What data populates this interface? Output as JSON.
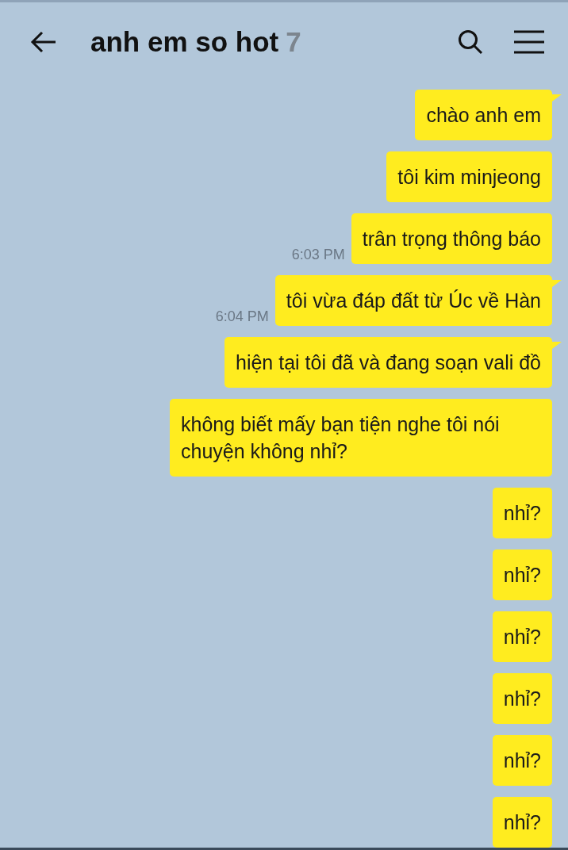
{
  "header": {
    "title": "anh em so hot",
    "member_count": "7"
  },
  "messages": [
    {
      "text": "chào anh em",
      "tail": true
    },
    {
      "text": "tôi kim minjeong",
      "tail": false
    },
    {
      "text": "trân trọng thông báo",
      "tail": false,
      "time": "6:03 PM"
    },
    {
      "text": "tôi vừa đáp đất từ Úc về Hàn",
      "tail": true,
      "time": "6:04 PM"
    },
    {
      "text": "hiện tại tôi đã và đang soạn vali đồ",
      "tail": true
    },
    {
      "text": "không biết mấy bạn tiện nghe tôi nói chuyện không nhỉ?",
      "tail": false
    },
    {
      "text": "nhỉ?",
      "tail": false
    },
    {
      "text": "nhỉ?",
      "tail": false
    },
    {
      "text": "nhỉ?",
      "tail": false
    },
    {
      "text": "nhỉ?",
      "tail": false
    },
    {
      "text": "nhỉ?",
      "tail": false
    },
    {
      "text": "nhỉ?",
      "tail": false
    }
  ]
}
